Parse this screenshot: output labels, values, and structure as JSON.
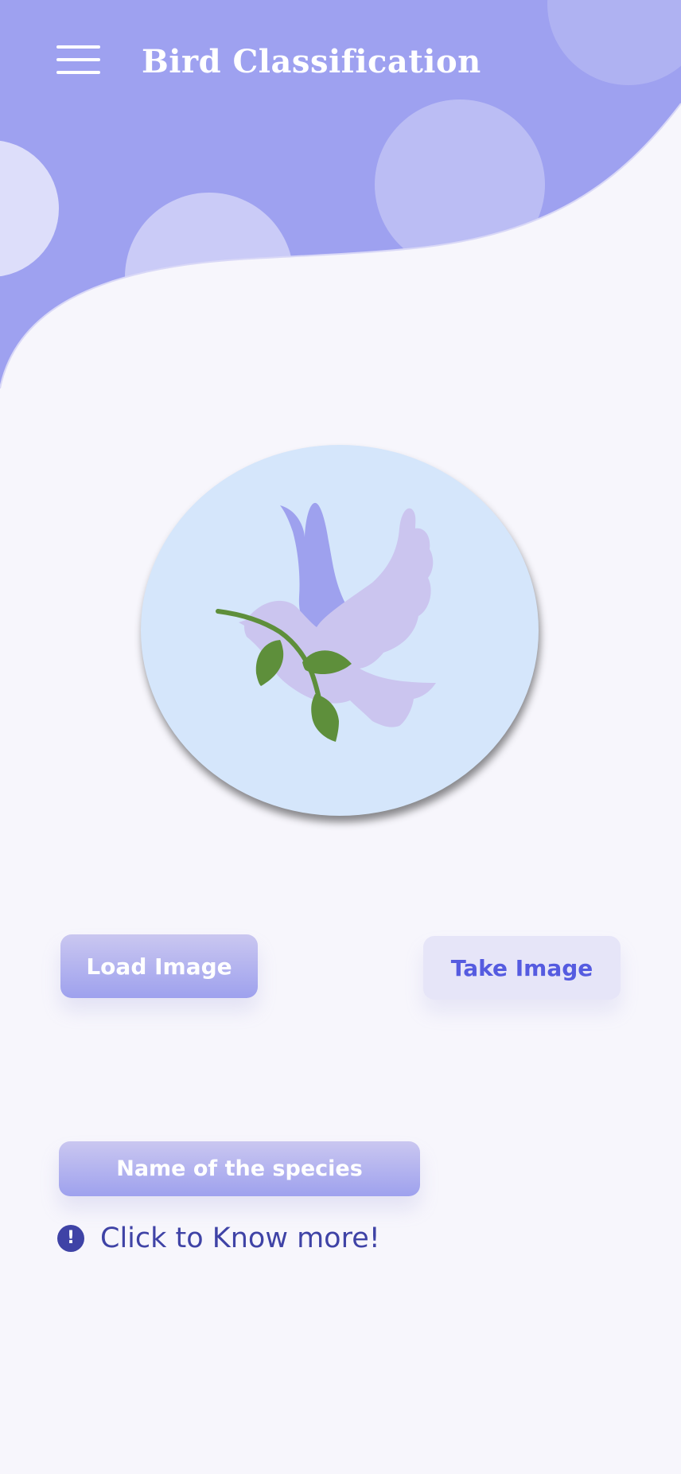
{
  "header": {
    "title": "Bird Classification",
    "menu_icon": "hamburger-menu-icon",
    "background_color": "#9ea1f0"
  },
  "preview": {
    "icon": "dove-with-olive-branch-icon",
    "background_color": "#d5e6fb"
  },
  "actions": {
    "load_image_label": "Load Image",
    "take_image_label": "Take Image"
  },
  "result": {
    "species_label": "Name of the species",
    "know_more_label": "Click to Know more!",
    "info_icon": "exclamation-circle-icon",
    "info_glyph": "!"
  },
  "colors": {
    "accent": "#9ea1ee",
    "text_accent": "#3f43a6",
    "take_image_text": "#555be0",
    "page_background": "#f7f6fc"
  }
}
